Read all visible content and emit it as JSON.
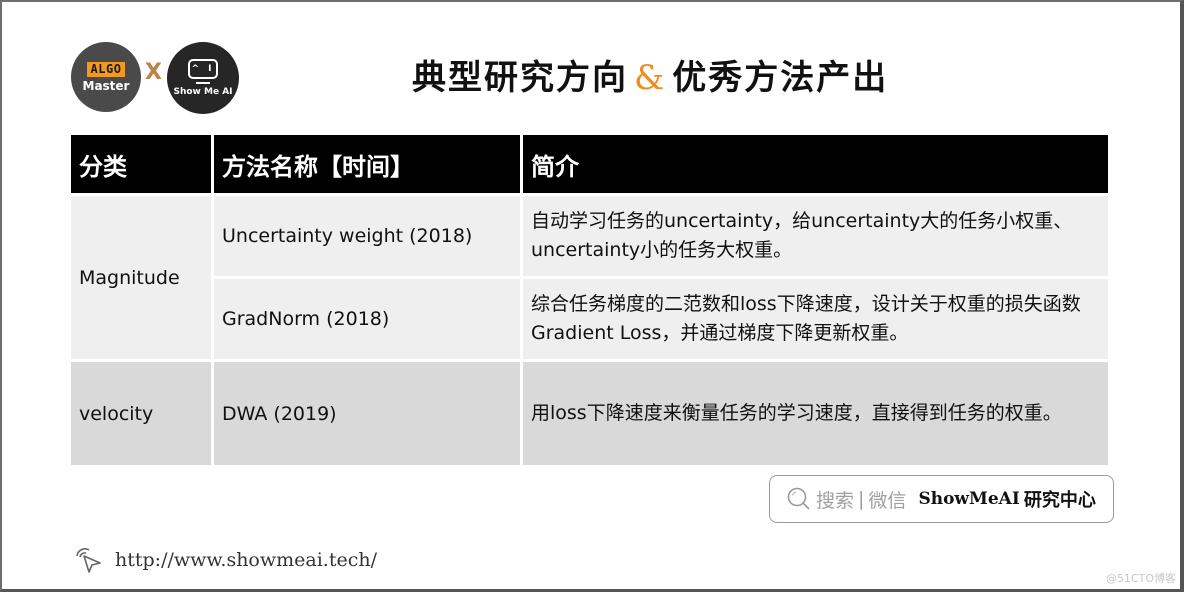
{
  "logos": {
    "algo_tag": "ALGO",
    "algo_master": "Master",
    "cross": "X",
    "showme_screen": "^ I",
    "showme_label": "Show Me AI"
  },
  "header": {
    "title_left": "典型研究方向",
    "title_amp": "&",
    "title_right": "优秀方法产出",
    "accent_color": "#f08c1e"
  },
  "table": {
    "columns": [
      "分类",
      "方法名称【时间】",
      "简介"
    ],
    "groups": [
      {
        "category": "Magnitude",
        "rows": [
          {
            "method": "Uncertainty weight (2018)",
            "description": "自动学习任务的uncertainty，给uncertainty大的任务小权重、uncertainty小的任务大权重。"
          },
          {
            "method": "GradNorm (2018)",
            "description": "综合任务梯度的二范数和loss下降速度，设计关于权重的损失函数Gradient Loss，并通过梯度下降更新权重。"
          }
        ]
      },
      {
        "category": "velocity",
        "rows": [
          {
            "method": "DWA (2019)",
            "description": "用loss下降速度来衡量任务的学习速度，直接得到任务的权重。"
          }
        ]
      }
    ]
  },
  "search_box": {
    "hint_left": "搜索",
    "separator": "|",
    "hint_right": "微信",
    "brand": "ShowMeAI",
    "brand_cn": "研究中心"
  },
  "footer": {
    "url": "http://www.showmeai.tech/",
    "watermark": "@51CTO博客"
  }
}
